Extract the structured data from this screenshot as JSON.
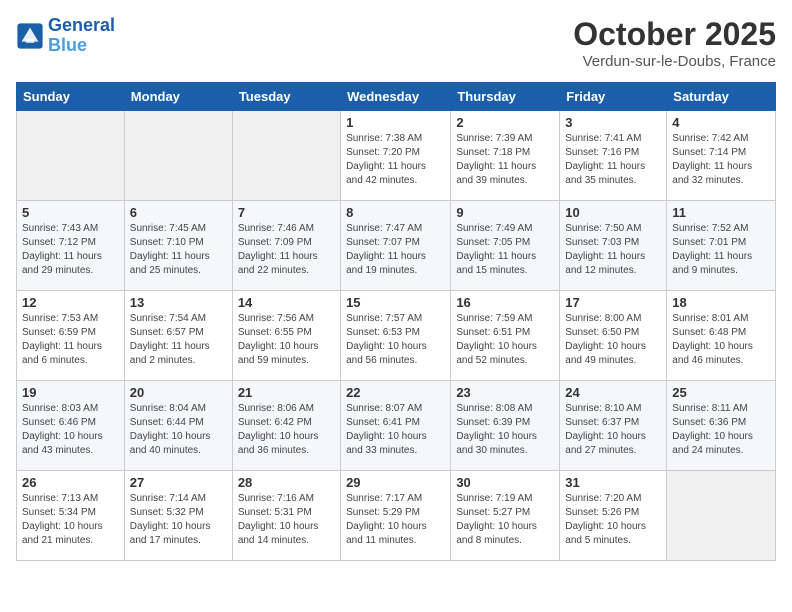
{
  "logo": {
    "line1": "General",
    "line2": "Blue"
  },
  "title": "October 2025",
  "location": "Verdun-sur-le-Doubs, France",
  "days_of_week": [
    "Sunday",
    "Monday",
    "Tuesday",
    "Wednesday",
    "Thursday",
    "Friday",
    "Saturday"
  ],
  "weeks": [
    [
      {
        "day": null,
        "info": null
      },
      {
        "day": null,
        "info": null
      },
      {
        "day": null,
        "info": null
      },
      {
        "day": "1",
        "info": "Sunrise: 7:38 AM\nSunset: 7:20 PM\nDaylight: 11 hours and 42 minutes."
      },
      {
        "day": "2",
        "info": "Sunrise: 7:39 AM\nSunset: 7:18 PM\nDaylight: 11 hours and 39 minutes."
      },
      {
        "day": "3",
        "info": "Sunrise: 7:41 AM\nSunset: 7:16 PM\nDaylight: 11 hours and 35 minutes."
      },
      {
        "day": "4",
        "info": "Sunrise: 7:42 AM\nSunset: 7:14 PM\nDaylight: 11 hours and 32 minutes."
      }
    ],
    [
      {
        "day": "5",
        "info": "Sunrise: 7:43 AM\nSunset: 7:12 PM\nDaylight: 11 hours and 29 minutes."
      },
      {
        "day": "6",
        "info": "Sunrise: 7:45 AM\nSunset: 7:10 PM\nDaylight: 11 hours and 25 minutes."
      },
      {
        "day": "7",
        "info": "Sunrise: 7:46 AM\nSunset: 7:09 PM\nDaylight: 11 hours and 22 minutes."
      },
      {
        "day": "8",
        "info": "Sunrise: 7:47 AM\nSunset: 7:07 PM\nDaylight: 11 hours and 19 minutes."
      },
      {
        "day": "9",
        "info": "Sunrise: 7:49 AM\nSunset: 7:05 PM\nDaylight: 11 hours and 15 minutes."
      },
      {
        "day": "10",
        "info": "Sunrise: 7:50 AM\nSunset: 7:03 PM\nDaylight: 11 hours and 12 minutes."
      },
      {
        "day": "11",
        "info": "Sunrise: 7:52 AM\nSunset: 7:01 PM\nDaylight: 11 hours and 9 minutes."
      }
    ],
    [
      {
        "day": "12",
        "info": "Sunrise: 7:53 AM\nSunset: 6:59 PM\nDaylight: 11 hours and 6 minutes."
      },
      {
        "day": "13",
        "info": "Sunrise: 7:54 AM\nSunset: 6:57 PM\nDaylight: 11 hours and 2 minutes."
      },
      {
        "day": "14",
        "info": "Sunrise: 7:56 AM\nSunset: 6:55 PM\nDaylight: 10 hours and 59 minutes."
      },
      {
        "day": "15",
        "info": "Sunrise: 7:57 AM\nSunset: 6:53 PM\nDaylight: 10 hours and 56 minutes."
      },
      {
        "day": "16",
        "info": "Sunrise: 7:59 AM\nSunset: 6:51 PM\nDaylight: 10 hours and 52 minutes."
      },
      {
        "day": "17",
        "info": "Sunrise: 8:00 AM\nSunset: 6:50 PM\nDaylight: 10 hours and 49 minutes."
      },
      {
        "day": "18",
        "info": "Sunrise: 8:01 AM\nSunset: 6:48 PM\nDaylight: 10 hours and 46 minutes."
      }
    ],
    [
      {
        "day": "19",
        "info": "Sunrise: 8:03 AM\nSunset: 6:46 PM\nDaylight: 10 hours and 43 minutes."
      },
      {
        "day": "20",
        "info": "Sunrise: 8:04 AM\nSunset: 6:44 PM\nDaylight: 10 hours and 40 minutes."
      },
      {
        "day": "21",
        "info": "Sunrise: 8:06 AM\nSunset: 6:42 PM\nDaylight: 10 hours and 36 minutes."
      },
      {
        "day": "22",
        "info": "Sunrise: 8:07 AM\nSunset: 6:41 PM\nDaylight: 10 hours and 33 minutes."
      },
      {
        "day": "23",
        "info": "Sunrise: 8:08 AM\nSunset: 6:39 PM\nDaylight: 10 hours and 30 minutes."
      },
      {
        "day": "24",
        "info": "Sunrise: 8:10 AM\nSunset: 6:37 PM\nDaylight: 10 hours and 27 minutes."
      },
      {
        "day": "25",
        "info": "Sunrise: 8:11 AM\nSunset: 6:36 PM\nDaylight: 10 hours and 24 minutes."
      }
    ],
    [
      {
        "day": "26",
        "info": "Sunrise: 7:13 AM\nSunset: 5:34 PM\nDaylight: 10 hours and 21 minutes."
      },
      {
        "day": "27",
        "info": "Sunrise: 7:14 AM\nSunset: 5:32 PM\nDaylight: 10 hours and 17 minutes."
      },
      {
        "day": "28",
        "info": "Sunrise: 7:16 AM\nSunset: 5:31 PM\nDaylight: 10 hours and 14 minutes."
      },
      {
        "day": "29",
        "info": "Sunrise: 7:17 AM\nSunset: 5:29 PM\nDaylight: 10 hours and 11 minutes."
      },
      {
        "day": "30",
        "info": "Sunrise: 7:19 AM\nSunset: 5:27 PM\nDaylight: 10 hours and 8 minutes."
      },
      {
        "day": "31",
        "info": "Sunrise: 7:20 AM\nSunset: 5:26 PM\nDaylight: 10 hours and 5 minutes."
      },
      {
        "day": null,
        "info": null
      }
    ]
  ]
}
